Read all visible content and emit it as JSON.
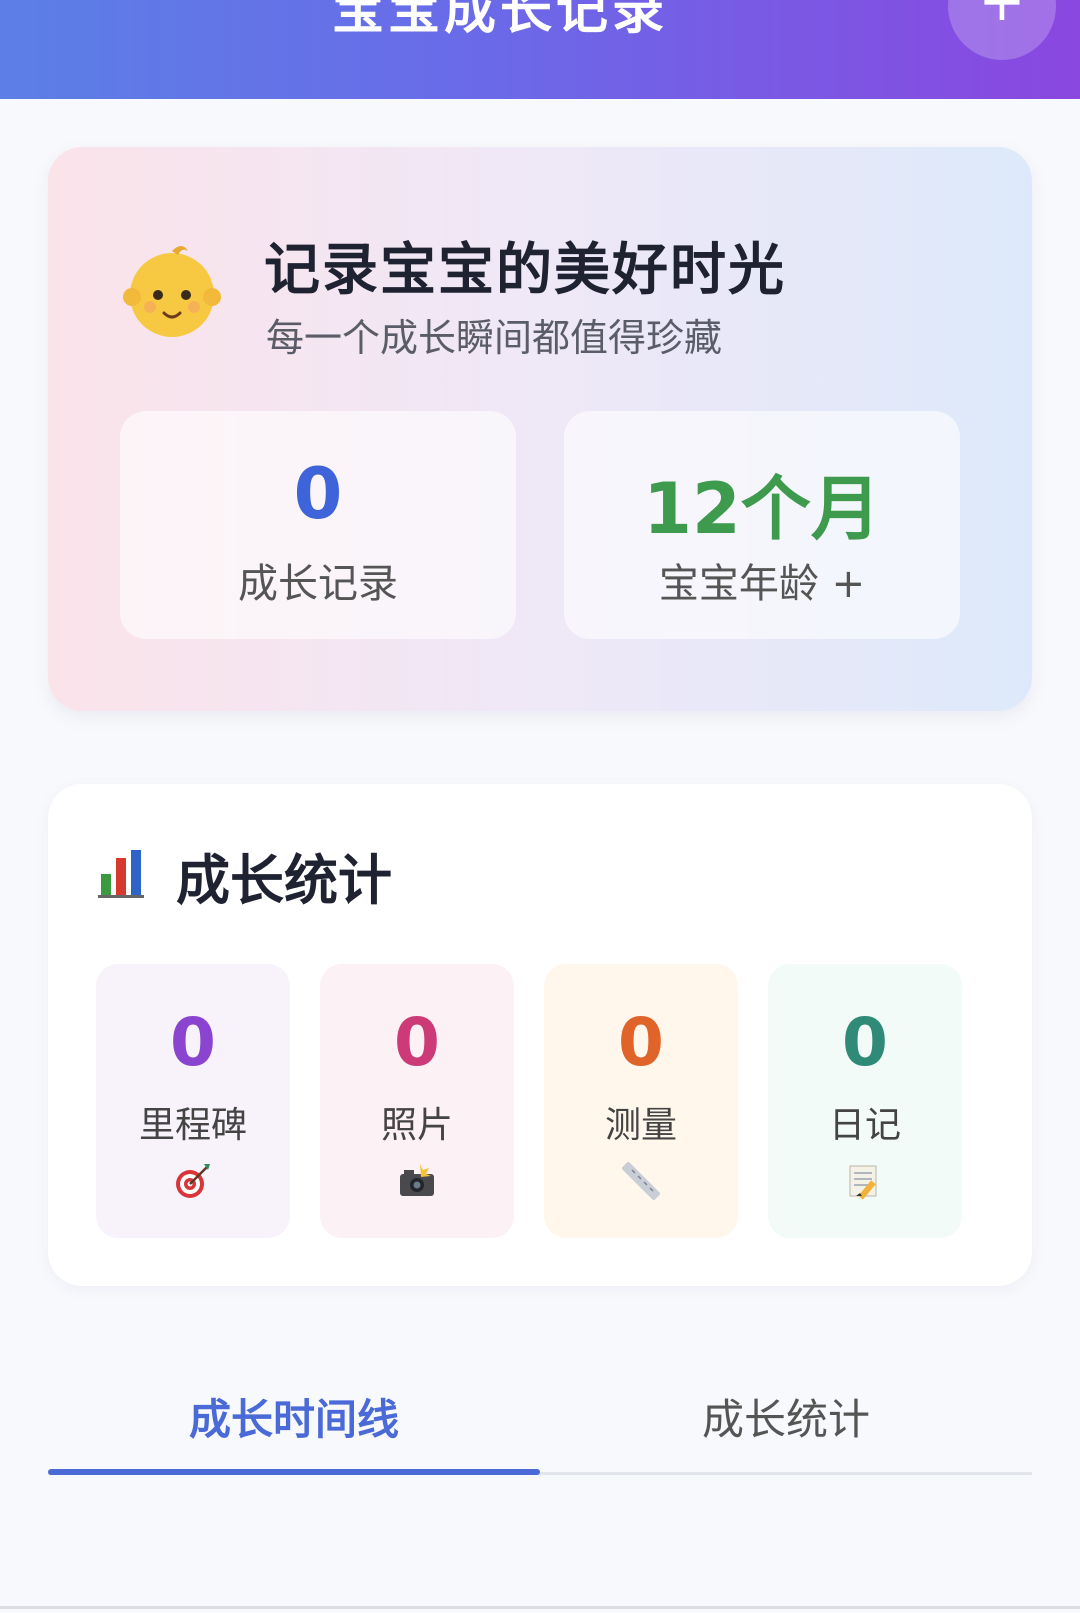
{
  "header": {
    "title": "宝宝成长记录",
    "add_label": "+"
  },
  "hero": {
    "avatar_icon": "baby-face-icon",
    "title": "记录宝宝的美好时光",
    "subtitle": "每一个成长瞬间都值得珍藏",
    "stats": [
      {
        "value": "0",
        "label": "成长记录",
        "color": "#3f63d8"
      },
      {
        "value": "12个月",
        "label": "宝宝年龄 +",
        "color": "#3e9a4c"
      }
    ]
  },
  "growth_stats": {
    "icon": "bar-chart-icon",
    "title": "成长统计",
    "tiles": [
      {
        "value": "0",
        "label": "里程碑",
        "icon": "target-icon",
        "color": "#8b44d0",
        "bg": "#f8f3fb"
      },
      {
        "value": "0",
        "label": "照片",
        "icon": "camera-icon",
        "color": "#cc3a78",
        "bg": "#fcf1f5"
      },
      {
        "value": "0",
        "label": "测量",
        "icon": "ruler-icon",
        "color": "#e0632a",
        "bg": "#fff7ec"
      },
      {
        "value": "0",
        "label": "日记",
        "icon": "memo-icon",
        "color": "#2f8a78",
        "bg": "#f2fbf8"
      }
    ]
  },
  "tabs": {
    "items": [
      {
        "label": "成长时间线",
        "active": true,
        "color": "#4a6ad8"
      },
      {
        "label": "成长统计",
        "active": false,
        "color": "#555555"
      }
    ]
  }
}
